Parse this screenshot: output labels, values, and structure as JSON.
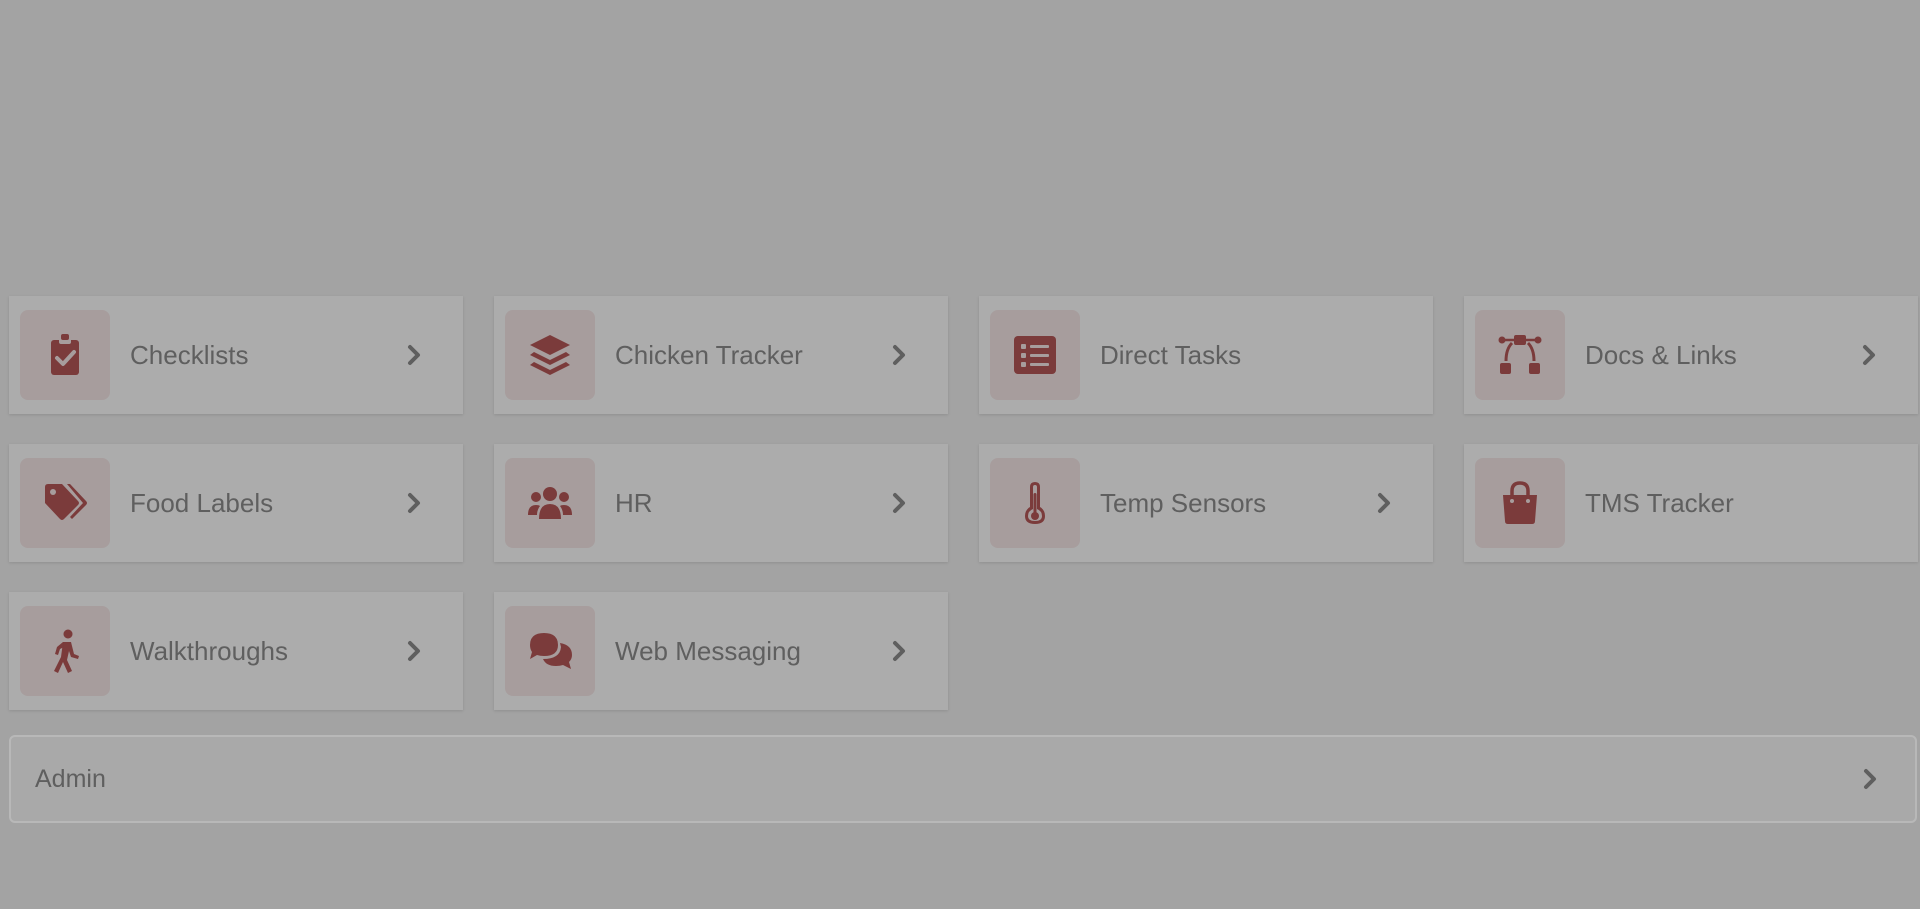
{
  "modules": [
    {
      "label": "Checklists",
      "icon": "clipboard-check-icon",
      "has_chevron": true
    },
    {
      "label": "Chicken Tracker",
      "icon": "layers-icon",
      "has_chevron": true
    },
    {
      "label": "Direct Tasks",
      "icon": "list-icon",
      "has_chevron": false
    },
    {
      "label": "Docs & Links",
      "icon": "bezier-curve-icon",
      "has_chevron": true
    },
    {
      "label": "Food Labels",
      "icon": "tags-icon",
      "has_chevron": true
    },
    {
      "label": "HR",
      "icon": "users-icon",
      "has_chevron": true
    },
    {
      "label": "Temp Sensors",
      "icon": "thermometer-icon",
      "has_chevron": true
    },
    {
      "label": "TMS Tracker",
      "icon": "shopping-bag-icon",
      "has_chevron": false
    },
    {
      "label": "Walkthroughs",
      "icon": "person-walking-icon",
      "has_chevron": true
    },
    {
      "label": "Web Messaging",
      "icon": "comments-icon",
      "has_chevron": true
    }
  ],
  "admin": {
    "label": "Admin"
  },
  "colors": {
    "overlay_background": "#a3a3a3",
    "tile_background": "#acacac",
    "icon_background": "#a79d9d",
    "icon_color": "#7b3b3b",
    "text_color": "#5f5f5f"
  }
}
